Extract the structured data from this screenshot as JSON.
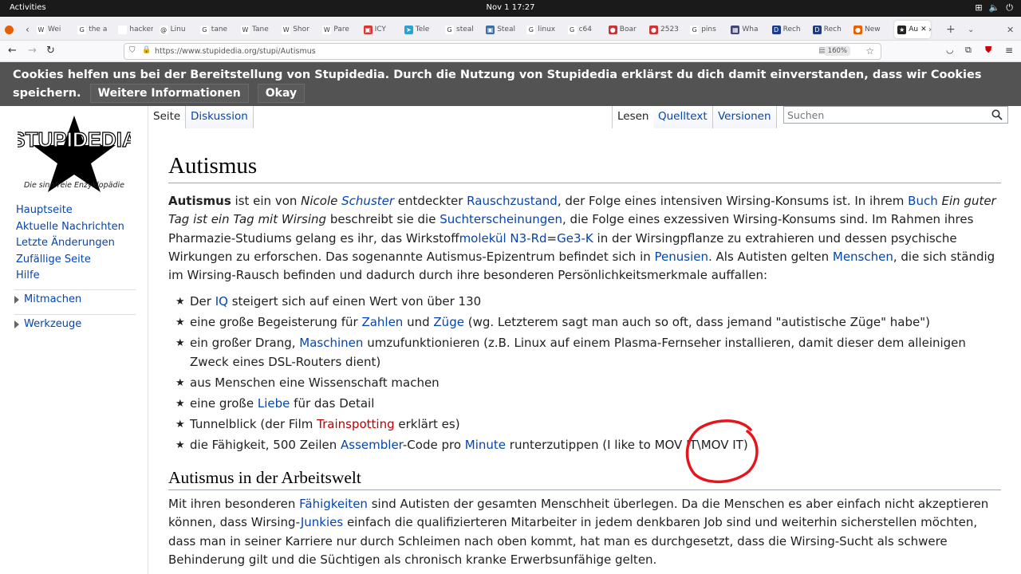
{
  "system": {
    "activities": "Activities",
    "clock": "Nov 1  17:27",
    "tray": [
      "⊞",
      "🔈",
      "⏻"
    ]
  },
  "tabs": [
    {
      "label": "Wei",
      "fav": "W",
      "color": "#fff"
    },
    {
      "label": "the a",
      "fav": "G",
      "color": "#fff"
    },
    {
      "label": "hackers",
      "fav": "",
      "color": "#fff"
    },
    {
      "label": "Linu",
      "fav": "@",
      "color": "#fff"
    },
    {
      "label": "tane",
      "fav": "G",
      "color": "#fff"
    },
    {
      "label": "Tane",
      "fav": "W",
      "color": "#fff"
    },
    {
      "label": "Shor",
      "fav": "W",
      "color": "#fff"
    },
    {
      "label": "Pare",
      "fav": "W",
      "color": "#fff"
    },
    {
      "label": "ICY",
      "fav": "▣",
      "color": "#d33"
    },
    {
      "label": "Tele",
      "fav": "➤",
      "color": "#2a9fd8"
    },
    {
      "label": "steal",
      "fav": "G",
      "color": "#fff"
    },
    {
      "label": "Steal",
      "fav": "▣",
      "color": "#3a6ea5"
    },
    {
      "label": "linux",
      "fav": "G",
      "color": "#fff"
    },
    {
      "label": "c64",
      "fav": "G",
      "color": "#fff"
    },
    {
      "label": "Boar",
      "fav": "●",
      "color": "#c33"
    },
    {
      "label": "2523",
      "fav": "●",
      "color": "#c33"
    },
    {
      "label": "pins",
      "fav": "G",
      "color": "#fff"
    },
    {
      "label": "Wha",
      "fav": "▦",
      "color": "#447"
    },
    {
      "label": "Rech",
      "fav": "D",
      "color": "#1a3a8a"
    },
    {
      "label": "Rech",
      "fav": "D",
      "color": "#1a3a8a"
    },
    {
      "label": "New",
      "fav": "●",
      "color": "#e66000"
    },
    {
      "label": "Au",
      "fav": "★",
      "color": "#222"
    }
  ],
  "address": {
    "url": "https://www.stupidedia.org/stupi/Autismus",
    "zoom": "160%"
  },
  "cookie": {
    "text": "Cookies helfen uns bei der Bereitstellung von Stupidedia. Durch die Nutzung von Stupidedia erklärst du dich damit einverstanden, dass wir Cookies speichern.",
    "more": "Weitere Informationen",
    "ok": "Okay"
  },
  "sidebar": {
    "logo": "STUPIDEDIA",
    "slogan": "Die sinnfreie Enzyklopädie",
    "nav": [
      "Hauptseite",
      "Aktuelle Nachrichten",
      "Letzte Änderungen",
      "Zufällige Seite",
      "Hilfe"
    ],
    "portals": [
      "Mitmachen",
      "Werkzeuge"
    ]
  },
  "tabs_content": {
    "page": "Seite",
    "talk": "Diskussion",
    "read": "Lesen",
    "source": "Quelltext",
    "history": "Versionen",
    "search_ph": "Suchen"
  },
  "article": {
    "title": "Autismus",
    "p1": [
      [
        "b",
        "Autismus"
      ],
      [
        "t",
        " ist ein von "
      ],
      [
        "i",
        "Nicole "
      ],
      [
        "li",
        "Schuster"
      ],
      [
        "t",
        " entdeckter "
      ],
      [
        "l",
        "Rauschzustand"
      ],
      [
        "t",
        ", der Folge eines intensiven Wirsing-Konsums ist. In ihrem "
      ],
      [
        "l",
        "Buch"
      ],
      [
        "t",
        " "
      ],
      [
        "i",
        "Ein guter Tag ist ein Tag mit Wirsing"
      ],
      [
        "t",
        " beschreibt sie die "
      ],
      [
        "l",
        "Suchterscheinungen"
      ],
      [
        "t",
        ", die Folge eines exzessiven Wirsing-Konsums sind. Im Rahmen ihres Pharmazie-Studiums gelang es ihr, das Wirkstoff"
      ],
      [
        "l",
        "molekül N3-Rd"
      ],
      [
        "t",
        "="
      ],
      [
        "l",
        "Ge3-K"
      ],
      [
        "t",
        " in der Wirsingpflanze zu extrahieren und dessen psychische Wirkungen zu erforschen. Das sogenannte Autismus-Epizentrum befindet sich in "
      ],
      [
        "l",
        "Penusien"
      ],
      [
        "t",
        ". Als Autisten gelten "
      ],
      [
        "l",
        "Menschen"
      ],
      [
        "t",
        ", die sich ständig im Wirsing-Rausch befinden und dadurch durch ihre besonderen Persönlichkeitsmerkmale auffallen:"
      ]
    ],
    "list": [
      [
        [
          "t",
          "Der "
        ],
        [
          "l",
          "IQ"
        ],
        [
          "t",
          " steigert sich auf einen Wert von über 130"
        ]
      ],
      [
        [
          "t",
          "eine große Begeisterung für "
        ],
        [
          "l",
          "Zahlen"
        ],
        [
          "t",
          " und "
        ],
        [
          "l",
          "Züge"
        ],
        [
          "t",
          " (wg. Letzterem sagt man auch so oft, dass jemand \"autistische Züge\" habe\")"
        ]
      ],
      [
        [
          "t",
          "ein großer Drang, "
        ],
        [
          "l",
          "Maschinen"
        ],
        [
          "t",
          " umzufunktionieren (z.B. Linux auf einem Plasma-Fernseher installieren, damit dieser dem alleinigen Zweck eines DSL-Routers dient)"
        ]
      ],
      [
        [
          "t",
          "aus Menschen eine Wissenschaft machen"
        ]
      ],
      [
        [
          "t",
          "eine große "
        ],
        [
          "l",
          "Liebe"
        ],
        [
          "t",
          " für das Detail"
        ]
      ],
      [
        [
          "t",
          "Tunnelblick (der Film "
        ],
        [
          "r",
          "Trainspotting"
        ],
        [
          "t",
          " erklärt es)"
        ]
      ],
      [
        [
          "t",
          "die Fähigkeit, 500 Zeilen "
        ],
        [
          "l",
          "Assembler"
        ],
        [
          "t",
          "-Code pro "
        ],
        [
          "l",
          "Minute"
        ],
        [
          "t",
          " runterzutippen (I like to MOV IT\\MOV IT)"
        ]
      ]
    ],
    "h2": "Autismus in der Arbeitswelt",
    "p2": [
      [
        "t",
        "Mit ihren besonderen "
      ],
      [
        "l",
        "Fähigkeiten"
      ],
      [
        "t",
        " sind Autisten der gesamten Menschheit überlegen. Da die Menschen es aber einfach nicht akzeptieren können, dass Wirsing-"
      ],
      [
        "l",
        "Junkies"
      ],
      [
        "t",
        " einfach die qualifizierteren Mitarbeiter in jedem denkbaren Job sind und weiterhin sicherstellen möchten, dass man in seiner Karriere nur durch Schleimen nach oben kommt, hat man es durchgesetzt, dass die Wirsing-Sucht als schwere Behinderung gilt und die Süchtigen als chronisch kranke Erwerbsunfähige gelten."
      ]
    ]
  },
  "annotation_color": "#e8141c"
}
